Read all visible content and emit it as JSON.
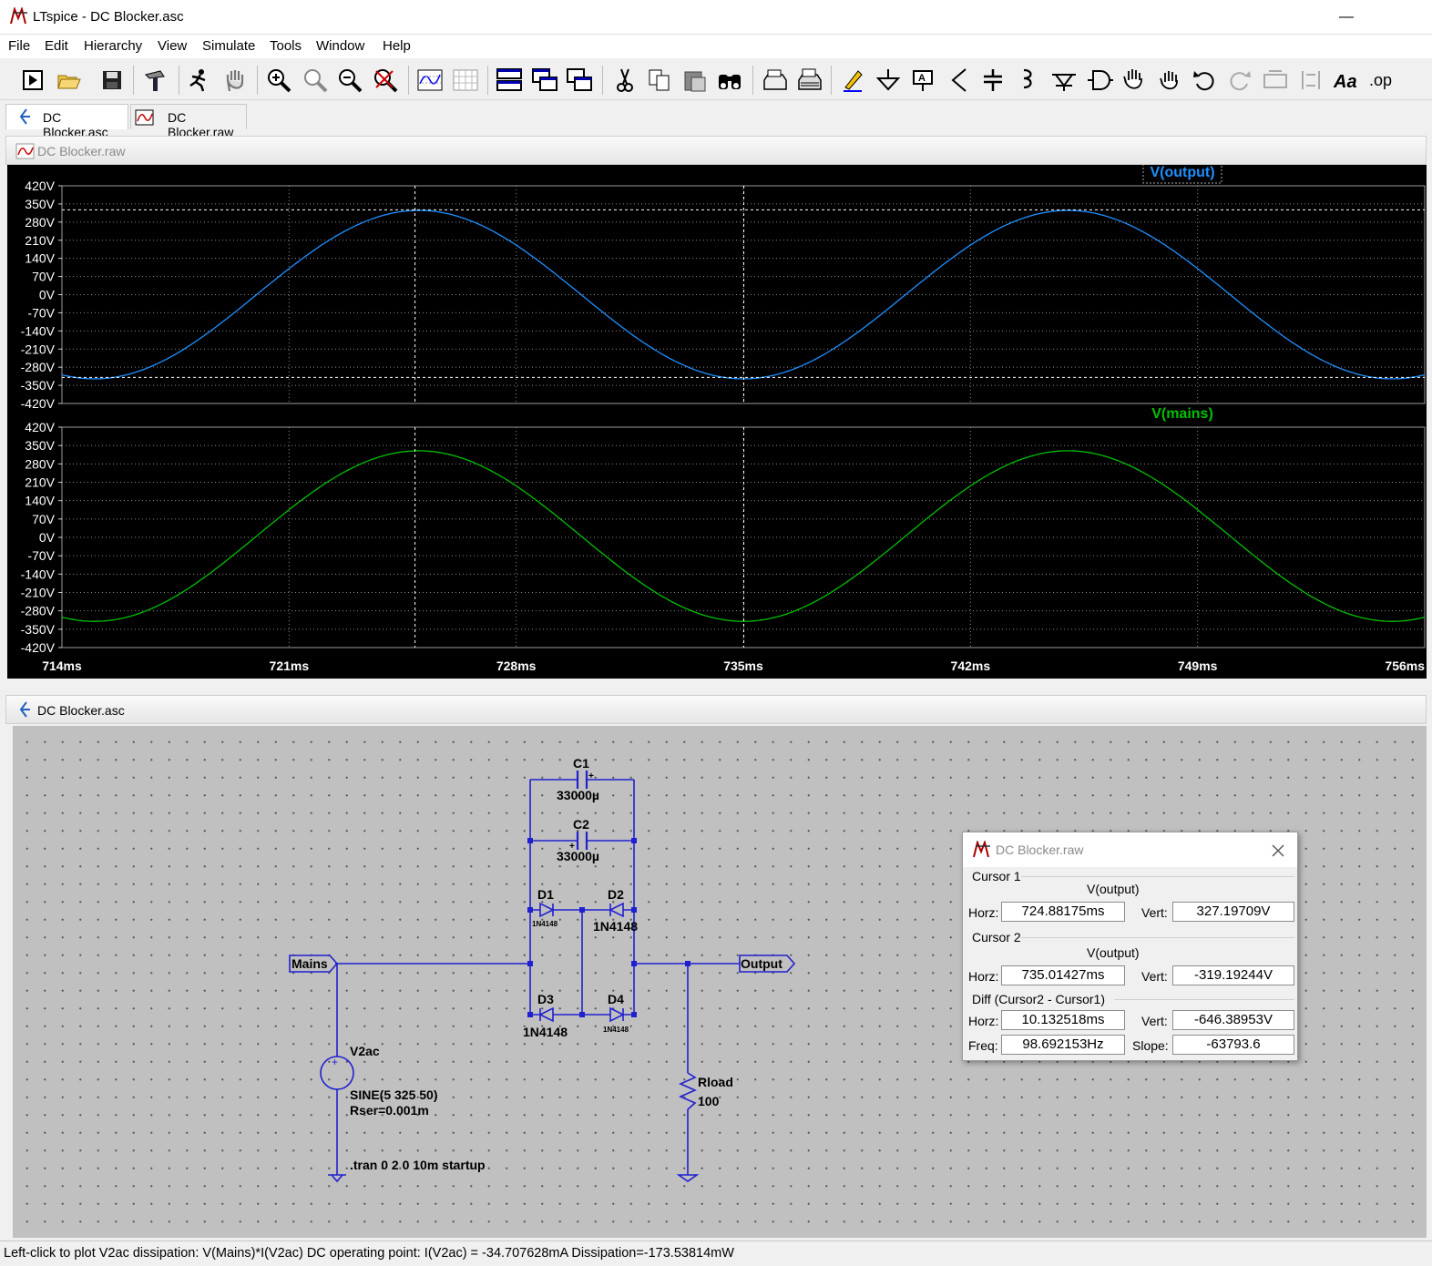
{
  "window": {
    "title": "LTspice - DC Blocker.asc",
    "minimize": "—",
    "maximize": "☐",
    "close": "✕"
  },
  "menu": [
    "File",
    "Edit",
    "Hierarchy",
    "View",
    "Simulate",
    "Tools",
    "Window",
    "Help"
  ],
  "tabs": [
    {
      "label": "DC Blocker.asc",
      "active": true
    },
    {
      "label": "DC Blocker.raw",
      "active": false
    }
  ],
  "waveform_pane": {
    "title": "DC Blocker.raw"
  },
  "schematic_pane": {
    "title": "DC Blocker.asc"
  },
  "chart_data": [
    {
      "type": "line",
      "series": [
        {
          "name": "V(output)",
          "color": "#1e90ff",
          "amplitude": 325,
          "frequency_hz": 50,
          "offset": 0
        }
      ],
      "xlim": [
        714,
        756
      ],
      "ylim": [
        -420,
        420
      ],
      "x_ticks": [
        "714ms",
        "721ms",
        "728ms",
        "735ms",
        "742ms",
        "749ms",
        "756ms"
      ],
      "y_ticks": [
        "420V",
        "350V",
        "280V",
        "210V",
        "140V",
        "70V",
        "0V",
        "-70V",
        "-140V",
        "-210V",
        "-280V",
        "-350V",
        "-420V"
      ],
      "cursor1": {
        "x": 724.88175,
        "y": 327.19709
      },
      "cursor2": {
        "x": 735.01427,
        "y": -319.19244
      }
    },
    {
      "type": "line",
      "series": [
        {
          "name": "V(mains)",
          "color": "#00c000",
          "amplitude": 325,
          "frequency_hz": 50,
          "offset": 5
        }
      ],
      "xlim": [
        714,
        756
      ],
      "ylim": [
        -420,
        420
      ],
      "y_ticks": [
        "420V",
        "350V",
        "280V",
        "210V",
        "140V",
        "70V",
        "0V",
        "-70V",
        "-140V",
        "-210V",
        "-280V",
        "-350V",
        "-420V"
      ]
    }
  ],
  "schematic": {
    "c1_name": "C1",
    "c1_value": "33000µ",
    "c2_name": "C2",
    "c2_value": "33000µ",
    "d1_name": "D1",
    "d1_model": "1N4148",
    "d2_name": "D2",
    "d2_model": "1N4148",
    "d3_name": "D3",
    "d3_model": "1N4148",
    "d4_name": "D4",
    "d4_model": "1N4148",
    "mains_label": "Mains",
    "output_label": "Output",
    "source_name": "V2ac",
    "source_value": "SINE(5 325 50)",
    "source_rser": "Rser=0.001m",
    "rload_name": "Rload",
    "rload_value": "100",
    "directive": ".tran 0 2 0 10m startup",
    "plus": "+"
  },
  "cursor_dialog": {
    "title": "DC Blocker.raw",
    "cursor1": {
      "label": "Cursor 1",
      "trace": "V(output)",
      "horz": "724.88175ms",
      "vert": "327.19709V"
    },
    "cursor2": {
      "label": "Cursor 2",
      "trace": "V(output)",
      "horz": "735.01427ms",
      "vert": "-319.19244V"
    },
    "diff": {
      "label": "Diff (Cursor2 - Cursor1)",
      "horz": "10.132518ms",
      "vert": "-646.38953V",
      "freq": "98.692153Hz",
      "slope": "-63793.6"
    },
    "labels": {
      "horz": "Horz:",
      "vert": "Vert:",
      "freq": "Freq:",
      "slope": "Slope:"
    }
  },
  "status": "Left-click to plot V2ac dissipation: V(Mains)*I(V2ac)  DC operating point: I(V2ac) = -34.707628mA   Dissipation=-173.53814mW"
}
